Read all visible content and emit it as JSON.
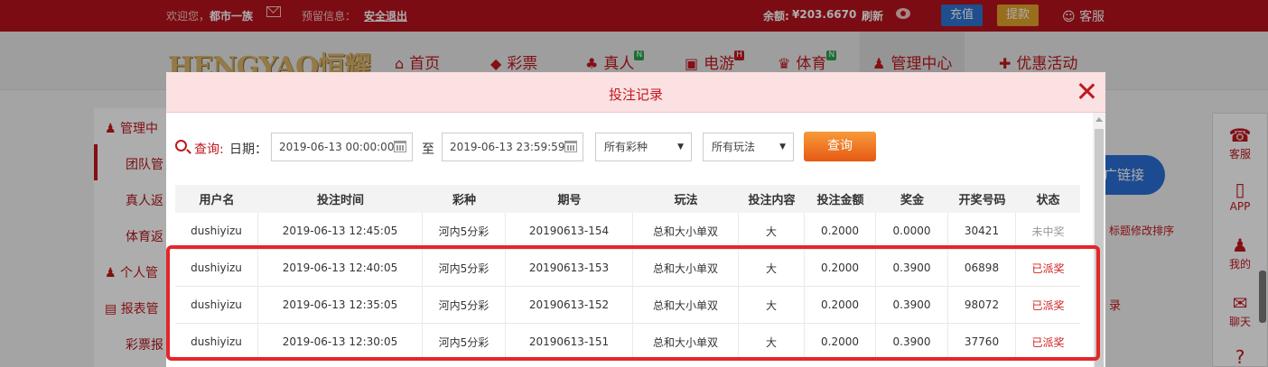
{
  "topbar": {
    "welcome": "欢迎您，",
    "username": "都市一族",
    "notice_label": "预留信息：",
    "logout": "安全退出",
    "balance_label": "余额:",
    "balance": "¥203.6670",
    "refresh": "刷新",
    "recharge": "充值",
    "withdraw": "提款",
    "service": "客服",
    "colors": {
      "bar": "#b7121c",
      "recharge": "#2d73d2",
      "withdraw": "#e0a32b"
    }
  },
  "nav": {
    "logo": "HENGYAO恒耀",
    "items": [
      {
        "label": "首页",
        "icon": "home-icon",
        "glyph": "⌂"
      },
      {
        "label": "彩票",
        "icon": "lottery-icon",
        "glyph": "◆"
      },
      {
        "label": "真人",
        "icon": "live-icon",
        "glyph": "♣",
        "badge": "N"
      },
      {
        "label": "电游",
        "icon": "slot-icon",
        "glyph": "▣",
        "badge": "H"
      },
      {
        "label": "体育",
        "icon": "trophy-icon",
        "glyph": "♛",
        "badge": "N"
      },
      {
        "label": "管理中心",
        "icon": "users-icon",
        "glyph": "♟"
      },
      {
        "label": "优惠活动",
        "icon": "gift-icon",
        "glyph": "✚"
      }
    ]
  },
  "left_menu": {
    "items": [
      "管理中",
      "团队管",
      "真人返",
      "体育返",
      "个人管",
      "报表管",
      "彩票报"
    ]
  },
  "right_frags": {
    "promo_link": "广链接",
    "sort_note": "标题修改排序",
    "record": "录"
  },
  "float_bar": {
    "items": [
      {
        "label": "客服",
        "icon": "headset-icon",
        "glyph": "☎"
      },
      {
        "label": "APP",
        "icon": "phone-icon",
        "glyph": "▯"
      },
      {
        "label": "我的",
        "icon": "user-icon",
        "glyph": "♟"
      },
      {
        "label": "聊天",
        "icon": "chat-icon",
        "glyph": "✉"
      },
      {
        "label": "",
        "icon": "help-icon",
        "glyph": "?"
      }
    ]
  },
  "modal": {
    "title": "投注记录",
    "filter": {
      "query_label": "查询:",
      "date_label": "日期：",
      "start_date": "2019-06-13 00:00:00",
      "to_label": "至",
      "end_date": "2019-06-13 23:59:59",
      "lottery_select": "所有彩种",
      "play_select": "所有玩法",
      "query_button": "查询"
    },
    "table": {
      "headers": [
        "用户名",
        "投注时间",
        "彩种",
        "期号",
        "玩法",
        "投注内容",
        "投注金额",
        "奖金",
        "开奖号码",
        "状态"
      ],
      "rows": [
        [
          "dushiyizu",
          "2019-06-13 12:45:05",
          "河内5分彩",
          "20190613-154",
          "总和大小单双",
          "大",
          "0.2000",
          "0.0000",
          "30421",
          "未中奖"
        ],
        [
          "dushiyizu",
          "2019-06-13 12:40:05",
          "河内5分彩",
          "20190613-153",
          "总和大小单双",
          "大",
          "0.2000",
          "0.3900",
          "06898",
          "已派奖"
        ],
        [
          "dushiyizu",
          "2019-06-13 12:35:05",
          "河内5分彩",
          "20190613-152",
          "总和大小单双",
          "大",
          "0.2000",
          "0.3900",
          "98072",
          "已派奖"
        ],
        [
          "dushiyizu",
          "2019-06-13 12:30:05",
          "河内5分彩",
          "20190613-151",
          "总和大小单双",
          "大",
          "0.2000",
          "0.3900",
          "37760",
          "已派奖"
        ]
      ]
    }
  }
}
